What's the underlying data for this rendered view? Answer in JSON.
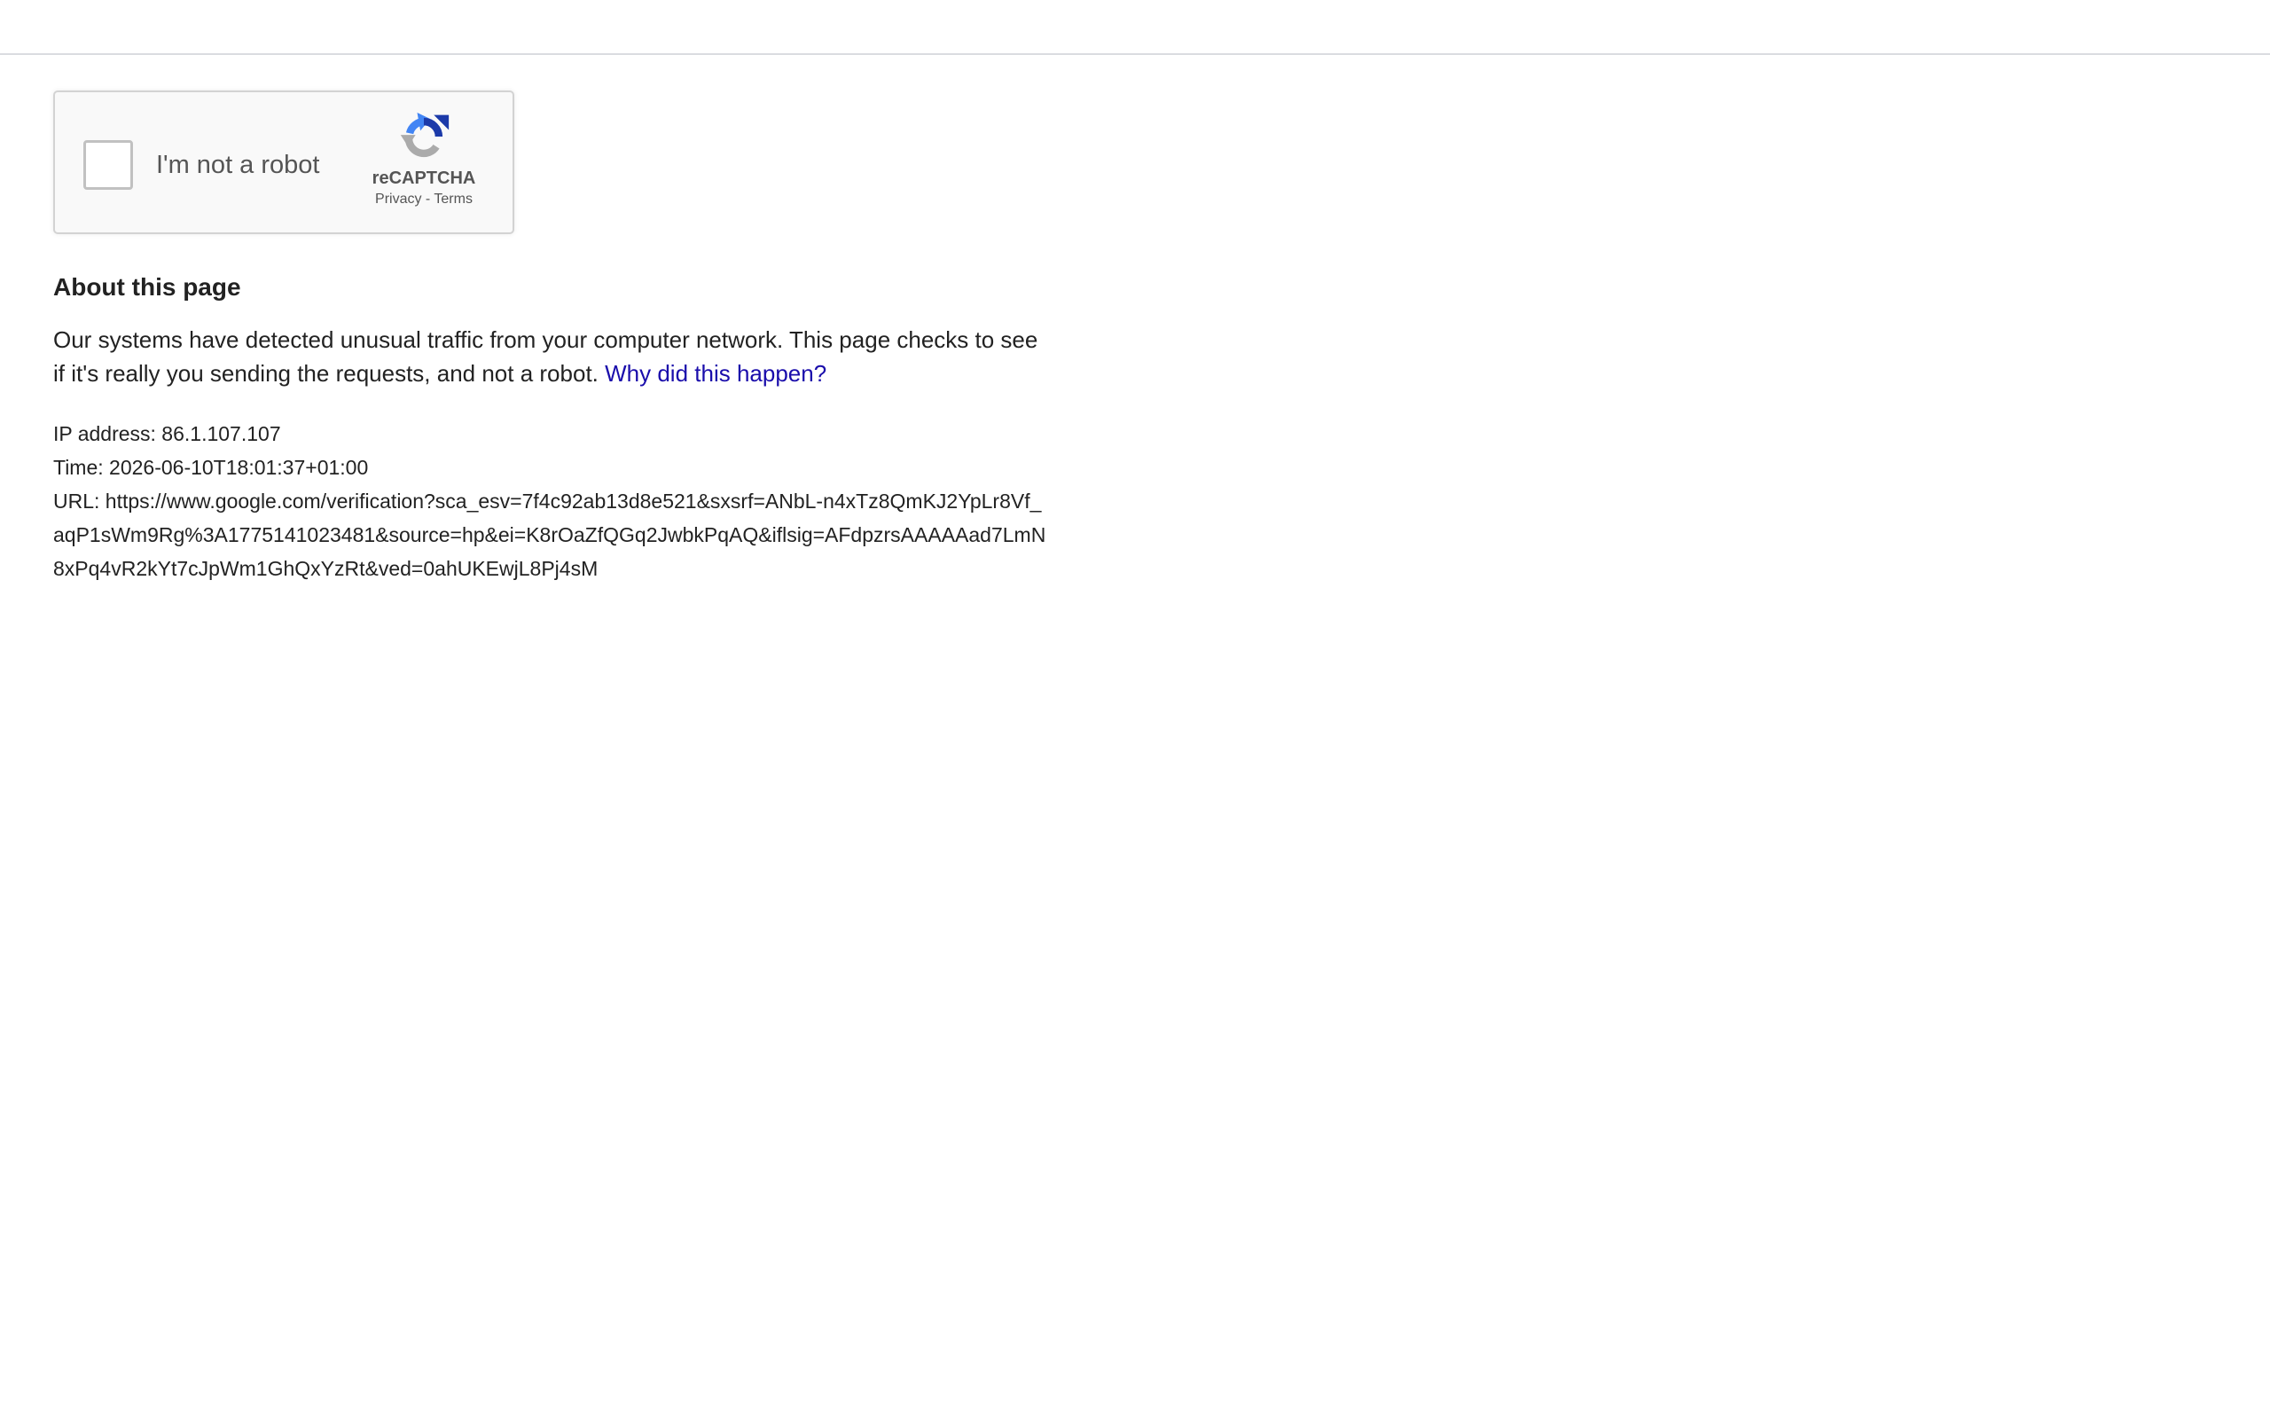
{
  "recaptcha": {
    "checkbox_label": "I'm not a robot",
    "checked": false,
    "brand": "reCAPTCHA",
    "privacy_label": "Privacy",
    "separator": " - ",
    "terms_label": "Terms",
    "logo_icon": "recaptcha-logo-icon",
    "colors": {
      "logo_blue": "#1c3aa9",
      "logo_light_blue": "#4285f4",
      "logo_gray": "#ababab"
    }
  },
  "about": {
    "title": "About this page",
    "text": "Our systems have detected unusual traffic from your computer network. This page checks to see if it's really you sending the requests, and not a robot.",
    "link_label": "Why did this happen?",
    "link_color": "#1a0dab"
  },
  "details": {
    "ip": "IP address: 86.1.107.107",
    "time": "Time: 2026-06-10T18:01:37+01:00",
    "url": "URL: https://www.google.com/verification?sca_esv=7f4c92ab13d8e521&sxsrf=ANbL-n4xTz8QmKJ2YpLr8Vf_aqP1sWm9Rg%3A1775141023481&source=hp&ei=K8rOaZfQGq2JwbkPqAQ&iflsig=AFdpzrsAAAAAad7LmN8xPq4vR2kYt7cJpWm1GhQxYzRt&ved=0ahUKEwjL8Pj4sM"
  }
}
